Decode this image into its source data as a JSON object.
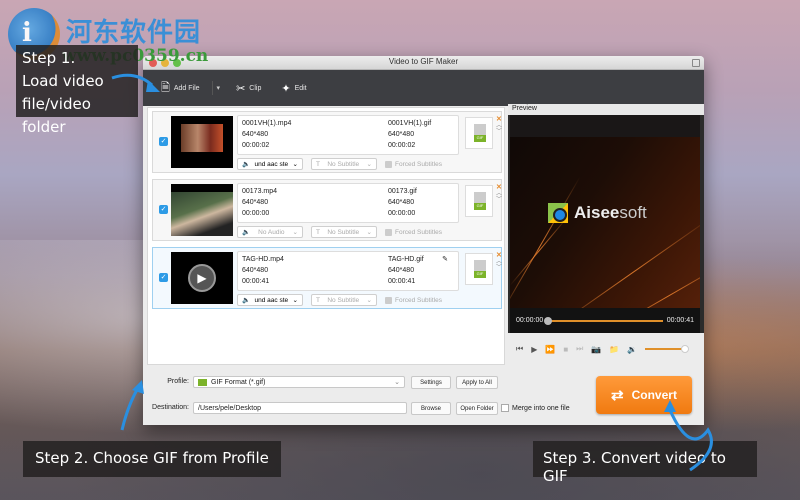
{
  "watermark": {
    "site_name": "河东软件园",
    "url": "www.pc0359.cn",
    "logo_glyph": "i"
  },
  "window": {
    "title": "Video to GIF Maker"
  },
  "toolbar": {
    "add_file": {
      "label": "Add File",
      "icon": "add-file-icon"
    },
    "dropdown": "▾",
    "clip": {
      "label": "Clip",
      "icon": "scissors-icon"
    },
    "edit": {
      "label": "Edit",
      "icon": "sparkle-icon"
    }
  },
  "files": [
    {
      "checked": true,
      "src_name": "0001VH(1).mp4",
      "src_res": "640*480",
      "src_dur": "00:00:02",
      "dst_name": "0001VH(1).gif",
      "dst_res": "640*480",
      "dst_dur": "00:00:02",
      "audio": "und aac ste",
      "subtitle": "No Subtitle",
      "forced": "Forced Subtitles",
      "format_badge": "GIF"
    },
    {
      "checked": true,
      "src_name": "00173.mp4",
      "src_res": "640*480",
      "src_dur": "00:00:00",
      "dst_name": "00173.gif",
      "dst_res": "640*480",
      "dst_dur": "00:00:00",
      "audio": "No Audio",
      "subtitle": "No Subtitle",
      "forced": "Forced Subtitles",
      "format_badge": "GIF"
    },
    {
      "checked": true,
      "selected": true,
      "src_name": "TAG-HD.mp4",
      "src_res": "640*480",
      "src_dur": "00:00:41",
      "dst_name": "TAG-HD.gif",
      "dst_res": "640*480",
      "dst_dur": "00:00:41",
      "audio": "und aac ste",
      "subtitle": "No Subtitle",
      "forced": "Forced Subtitles",
      "format_badge": "GIF"
    }
  ],
  "preview": {
    "label": "Preview",
    "brand_bold": "Aisee",
    "brand_light": "soft",
    "time_current": "00:00:00",
    "time_total": "00:00:41",
    "progress": 0,
    "volume": 1.0
  },
  "bottom": {
    "profile_label": "Profile:",
    "profile_value": "GIF Format (*.gif)",
    "settings": "Settings",
    "apply_all": "Apply to All",
    "destination_label": "Destination:",
    "destination_value": "/Users/pele/Desktop",
    "browse": "Browse",
    "open_folder": "Open Folder",
    "merge": "Merge into one file",
    "convert": "Convert"
  },
  "steps": {
    "step1_line1": "Step 1.",
    "step1_line2": "Load video",
    "step1_line3": "file/video folder",
    "step2": "Step 2. Choose GIF from Profile",
    "step3": "Step 3. Convert video to GIF"
  },
  "colors": {
    "accent_orange": "#f07a10",
    "check_blue": "#2d9be6",
    "arrow_blue": "#2a8fe0"
  }
}
